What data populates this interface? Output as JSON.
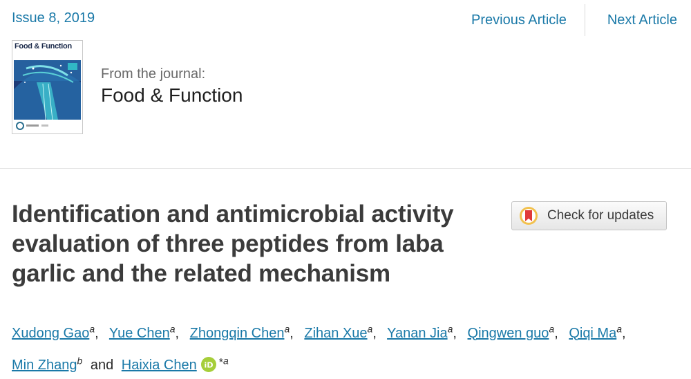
{
  "header": {
    "issue": "Issue 8, 2019",
    "prev_article": "Previous Article",
    "next_article": "Next Article"
  },
  "journal": {
    "cover_title": "Food & Function",
    "from_label": "From the journal:",
    "name": "Food & Function"
  },
  "article": {
    "title": "Identification and antimicrobial activity evaluation of three peptides from laba garlic and the related mechanism",
    "check_updates": "Check for updates"
  },
  "authors": [
    {
      "name": "Xudong Gao",
      "aff": "a"
    },
    {
      "name": "Yue Chen",
      "aff": "a"
    },
    {
      "name": "Zhongqin Chen",
      "aff": "a"
    },
    {
      "name": "Zihan Xue",
      "aff": "a"
    },
    {
      "name": "Yanan Jia",
      "aff": "a"
    },
    {
      "name": "Qingwen guo",
      "aff": "a"
    },
    {
      "name": "Qiqi Ma",
      "aff": "a"
    },
    {
      "name": "Min Zhang",
      "aff": "b"
    },
    {
      "name": "Haixia Chen",
      "aff": "a",
      "corresponding_mark": "*"
    }
  ],
  "authors_and": "and",
  "icons": {
    "orcid": "orcid-icon",
    "crossmark": "crossmark-icon"
  },
  "colors": {
    "link": "#1a79a8",
    "orcid": "#a6ce39",
    "crossmark_red": "#e03a3a"
  }
}
